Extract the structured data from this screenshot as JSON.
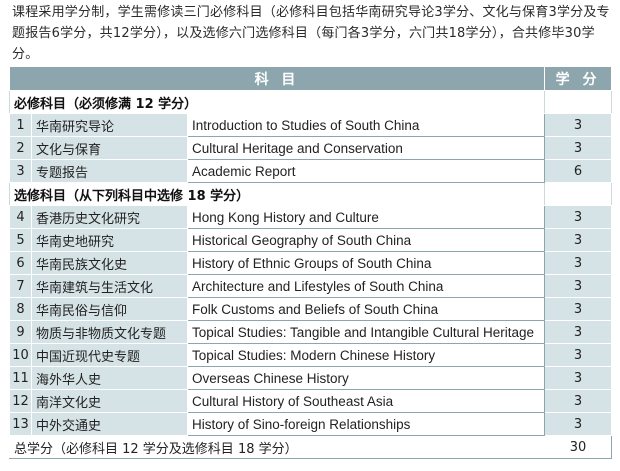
{
  "intro_text": "课程采用学分制，学生需修读三门必修科目（必修科目包括华南研究导论3学分、文化与保育3学分及专题报告6学分，共12学分），以及选修六门选修科目（每门各3学分，六门共18学分），合共修毕30学分。",
  "header": {
    "subject": "科 目",
    "credits": "学 分"
  },
  "required_heading": "必修科目（必须修满 12 学分）",
  "required": [
    {
      "no": "1",
      "zh": "华南研究导论",
      "en": "Introduction to Studies of South China",
      "credits": "3"
    },
    {
      "no": "2",
      "zh": "文化与保育",
      "en": "Cultural Heritage and Conservation",
      "credits": "3"
    },
    {
      "no": "3",
      "zh": "专题报告",
      "en": "Academic Report",
      "credits": "6"
    }
  ],
  "elective_heading": "选修科目（从下列科目中选修 18 学分）",
  "electives": [
    {
      "no": "4",
      "zh": "香港历史文化研究",
      "en": "Hong Kong History and Culture",
      "credits": "3"
    },
    {
      "no": "5",
      "zh": "华南史地研究",
      "en": "Historical Geography of South China",
      "credits": "3"
    },
    {
      "no": "6",
      "zh": "华南民族文化史",
      "en": "History of Ethnic Groups of South China",
      "credits": "3"
    },
    {
      "no": "7",
      "zh": "华南建筑与生活文化",
      "en": "Architecture and Lifestyles of South China",
      "credits": "3"
    },
    {
      "no": "8",
      "zh": "华南民俗与信仰",
      "en": "Folk Customs and Beliefs of South China",
      "credits": "3"
    },
    {
      "no": "9",
      "zh": "物质与非物质文化专题",
      "en": "Topical Studies: Tangible and Intangible Cultural Heritage",
      "credits": "3"
    },
    {
      "no": "10",
      "zh": "中国近现代史专题",
      "en": "Topical Studies: Modern Chinese History",
      "credits": "3"
    },
    {
      "no": "11",
      "zh": "海外华人史",
      "en": "Overseas Chinese History",
      "credits": "3"
    },
    {
      "no": "12",
      "zh": "南洋文化史",
      "en": "Cultural History of Southeast Asia",
      "credits": "3"
    },
    {
      "no": "13",
      "zh": "中外交通史",
      "en": "History of Sino-foreign Relationships",
      "credits": "3"
    }
  ],
  "total": {
    "label": "总学分（必修科目 12 学分及选修科目 18 学分）",
    "value": "30"
  }
}
